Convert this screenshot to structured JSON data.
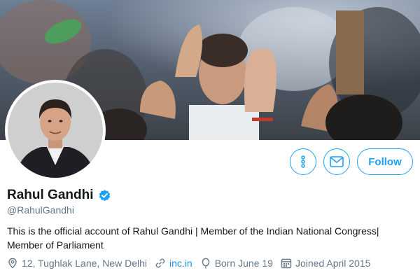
{
  "profile": {
    "name": "Rahul Gandhi",
    "handle": "@RahulGandhi",
    "verified": true,
    "bio": "This is the official account of Rahul Gandhi | Member of the Indian National Congress| Member of Parliament"
  },
  "meta": {
    "location": "12, Tughlak Lane, New Delhi",
    "website": "inc.in",
    "born": "Born June 19",
    "joined": "Joined April 2015"
  },
  "actions": {
    "follow_label": "Follow",
    "more_icon": "more-vertical-icon",
    "message_icon": "envelope-icon"
  },
  "colors": {
    "accent": "#1da1f2",
    "secondary_text": "#657786",
    "link": "#1b95e0"
  }
}
